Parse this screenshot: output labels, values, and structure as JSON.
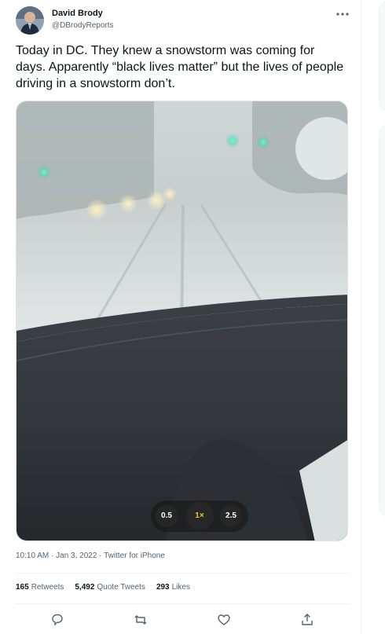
{
  "author": {
    "name": "David Brody",
    "handle": "@DBrodyReports"
  },
  "tweet": {
    "text": "Today in DC. They knew a snowstorm was coming for days. Apparently “black lives matter” but the lives of people driving in a snowstorm don’t."
  },
  "camera_zoom": {
    "options": [
      "0.5",
      "1×",
      "2.5"
    ],
    "selected": "1×"
  },
  "meta": {
    "time": "10:10 AM",
    "date": "Jan 3, 2022",
    "source": "Twitter for iPhone",
    "line": "10:10 AM · Jan 3, 2022 · Twitter for iPhone"
  },
  "stats": {
    "retweets_count": "165",
    "retweets_label": "Retweets",
    "quotes_count": "5,492",
    "quotes_label": "Quote Tweets",
    "likes_count": "293",
    "likes_label": "Likes"
  },
  "icons": {
    "more": "more-icon",
    "reply": "reply-icon",
    "retweet": "retweet-icon",
    "like": "like-icon",
    "share": "share-icon"
  },
  "colors": {
    "text_primary": "#0f1419",
    "text_secondary": "#536471",
    "divider": "#eff3f4",
    "zoom_active": "#f4c430"
  }
}
